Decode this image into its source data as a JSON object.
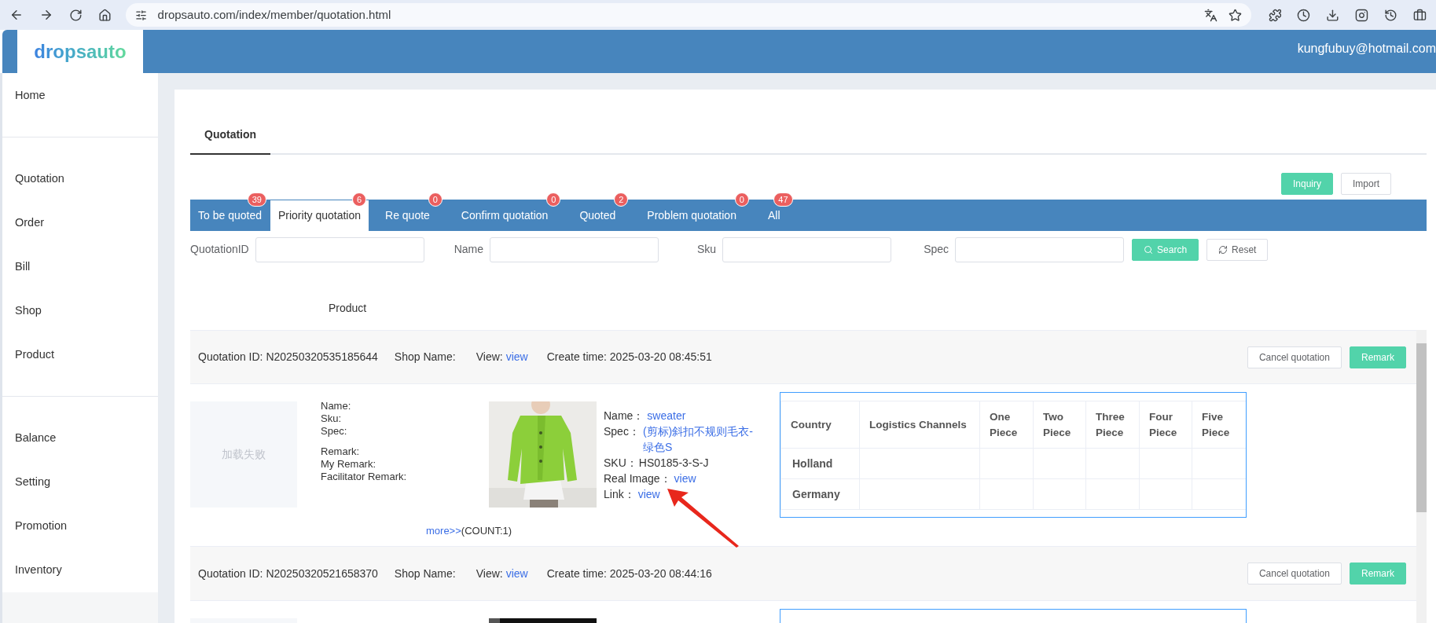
{
  "browser": {
    "url": "dropsauto.com/index/member/quotation.html"
  },
  "header": {
    "logo": "dropsauto",
    "user": "kungfubuy@hotmail.com"
  },
  "sidebar": {
    "groups": [
      {
        "items": [
          "Home"
        ]
      },
      {
        "items": [
          "Quotation",
          "Order",
          "Bill",
          "Shop",
          "Product"
        ]
      },
      {
        "items": [
          "Balance",
          "Setting",
          "Promotion",
          "Inventory"
        ]
      }
    ]
  },
  "page_tabs": [
    {
      "label": "Quotation",
      "selected": true
    }
  ],
  "actions": [
    {
      "label": "Inquiry",
      "kind": "primary"
    },
    {
      "label": "Import",
      "kind": "default"
    }
  ],
  "status_tabs": [
    {
      "label": "To be quoted",
      "count": "39",
      "selected": false
    },
    {
      "label": "Priority quotation",
      "count": "6",
      "selected": true
    },
    {
      "label": "Re quote",
      "count": "0",
      "selected": false
    },
    {
      "label": "Confirm quotation",
      "count": "0",
      "selected": false
    },
    {
      "label": "Quoted",
      "count": "2",
      "selected": false
    },
    {
      "label": "Problem quotation",
      "count": "0",
      "selected": false
    },
    {
      "label": "All",
      "count": "47",
      "selected": false
    }
  ],
  "filters": [
    {
      "label": "QuotationID"
    },
    {
      "label": "Name"
    },
    {
      "label": "Sku"
    },
    {
      "label": "Spec"
    }
  ],
  "filter_buttons": [
    {
      "label": "Search",
      "kind": "primary"
    },
    {
      "label": "Reset",
      "kind": "default"
    }
  ],
  "list_header": "Product",
  "quotes": [
    {
      "id": "Quotation ID: N20250320535185644",
      "shop": "Shop Name:",
      "view_label": "View:",
      "view_link": "view",
      "created": "Create time: 2025-03-20 08:45:51",
      "buttons": [
        {
          "label": "Cancel quotation",
          "kind": "default"
        },
        {
          "label": "Remark",
          "kind": "primary"
        }
      ],
      "product": {
        "image_error": "加载失败",
        "fields": [
          "Name:",
          "Sku:",
          "Spec:"
        ],
        "remarks": [
          "Remark:",
          "My Remark:",
          "Facilitator Remark:"
        ],
        "details": [
          {
            "label": "Name：",
            "value": "sweater",
            "kind": "link"
          },
          {
            "label": "Spec：",
            "value": "(剪标)斜扣不规则毛衣-绿色S",
            "kind": "link"
          },
          {
            "label": "SKU：",
            "value": "HS0185-3-S-J",
            "kind": "text"
          },
          {
            "label": "Real Image：",
            "value": "view",
            "kind": "link"
          },
          {
            "label": "Link：",
            "value": "view",
            "kind": "link"
          }
        ],
        "more_link": "more>>",
        "count": "(COUNT:1)",
        "table": {
          "columns": [
            "Country",
            "Logistics Channels",
            "One Piece",
            "Two Piece",
            "Three Piece",
            "Four Piece",
            "Five Piece"
          ],
          "rows": [
            {
              "country": "Holland"
            },
            {
              "country": "Germany"
            }
          ]
        }
      }
    },
    {
      "id": "Quotation ID: N20250320521658370",
      "shop": "Shop Name:",
      "view_label": "View:",
      "view_link": "view",
      "created": "Create time: 2025-03-20 08:44:16",
      "buttons": [
        {
          "label": "Cancel quotation",
          "kind": "default"
        },
        {
          "label": "Remark",
          "kind": "primary"
        }
      ]
    }
  ]
}
